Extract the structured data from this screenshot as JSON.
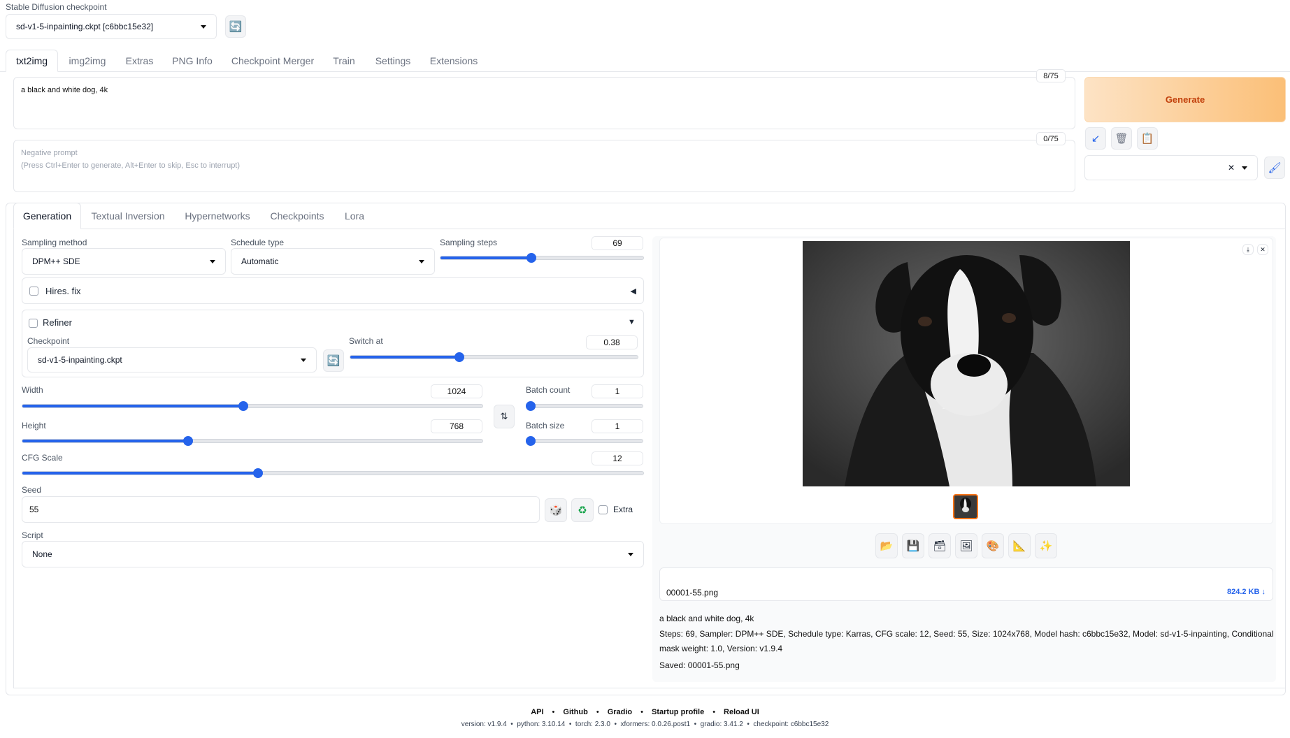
{
  "checkpoint": {
    "label": "Stable Diffusion checkpoint",
    "value": "sd-v1-5-inpainting.ckpt [c6bbc15e32]"
  },
  "tabs": [
    "txt2img",
    "img2img",
    "Extras",
    "PNG Info",
    "Checkpoint Merger",
    "Train",
    "Settings",
    "Extensions"
  ],
  "prompt": {
    "value": "a black and white dog, 4k",
    "token_count": "8/75"
  },
  "negative_prompt": {
    "placeholder": "Negative prompt",
    "hint": "(Press Ctrl+Enter to generate, Alt+Enter to skip, Esc to interrupt)",
    "token_count": "0/75"
  },
  "generate_label": "Generate",
  "subtabs": [
    "Generation",
    "Textual Inversion",
    "Hypernetworks",
    "Checkpoints",
    "Lora"
  ],
  "sampling": {
    "method_label": "Sampling method",
    "method": "DPM++ SDE",
    "schedule_label": "Schedule type",
    "schedule": "Automatic",
    "steps_label": "Sampling steps",
    "steps": "69",
    "steps_fraction": 0.45
  },
  "hires": {
    "label": "Hires. fix",
    "arrow": "◀"
  },
  "refiner": {
    "label": "Refiner",
    "arrow": "▼",
    "checkpoint_label": "Checkpoint",
    "checkpoint": "sd-v1-5-inpainting.ckpt",
    "switch_label": "Switch at",
    "switch": "0.38",
    "switch_fraction": 0.38
  },
  "size": {
    "width_label": "Width",
    "width": "1024",
    "width_fraction": 0.48,
    "height_label": "Height",
    "height": "768",
    "height_fraction": 0.36,
    "batch_count_label": "Batch count",
    "batch_count": "1",
    "batch_size_label": "Batch size",
    "batch_size": "1"
  },
  "cfg": {
    "label": "CFG Scale",
    "value": "12",
    "fraction": 0.38
  },
  "seed": {
    "label": "Seed",
    "value": "55",
    "extra_label": "Extra"
  },
  "script": {
    "label": "Script",
    "value": "None"
  },
  "output": {
    "filename": "00001-55.png",
    "filesize": "824.2 KB ↓",
    "info_prompt": "a black and white dog, 4k",
    "info_params": "Steps: 69, Sampler: DPM++ SDE, Schedule type: Karras, CFG scale: 12, Seed: 55, Size: 1024x768, Model hash: c6bbc15e32, Model: sd-v1-5-inpainting, Conditional mask weight: 1.0, Version: v1.9.4",
    "saved": "Saved: 00001-55.png"
  },
  "footer": {
    "links": [
      "API",
      "Github",
      "Gradio",
      "Startup profile",
      "Reload UI"
    ],
    "version_line": "version: v1.9.4  •  python: 3.10.14  •  torch: 2.3.0  •  xformers: 0.0.26.post1  •  gradio: 3.41.2  •  checkpoint: c6bbc15e32"
  },
  "colors": {
    "accent": "#2563eb",
    "generate": "#fbbf77",
    "generate_text": "#c2410c"
  }
}
